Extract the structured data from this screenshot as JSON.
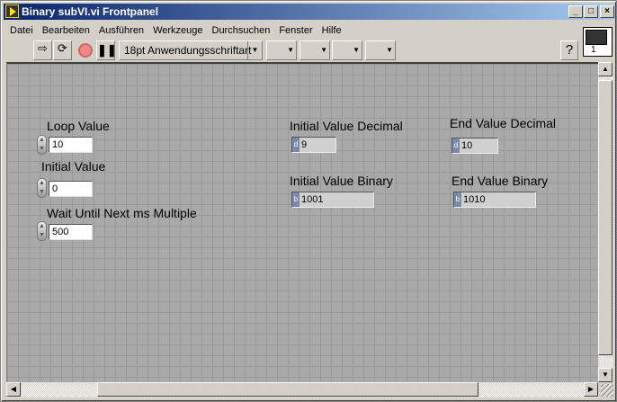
{
  "window": {
    "title": "Binary subVI.vi Frontpanel"
  },
  "menu": [
    "Datei",
    "Bearbeiten",
    "Ausführen",
    "Werkzeuge",
    "Durchsuchen",
    "Fenster",
    "Hilfe"
  ],
  "toolbar": {
    "font": "18pt Anwendungsschriftart",
    "help": "?",
    "connector_number": "1"
  },
  "controls": [
    {
      "label": "Loop Value",
      "value": "10"
    },
    {
      "label": "Initial Value",
      "value": "0"
    },
    {
      "label": "Wait Until Next ms Multiple",
      "value": "500"
    }
  ],
  "indicators": [
    {
      "label": "Initial Value Decimal",
      "radix": "d",
      "value": "9"
    },
    {
      "label": "End Value Decimal",
      "radix": "d",
      "value": "10"
    },
    {
      "label": "Initial Value Binary",
      "radix": "b",
      "value": "1001"
    },
    {
      "label": "End Value Binary",
      "radix": "b",
      "value": "1010"
    }
  ]
}
